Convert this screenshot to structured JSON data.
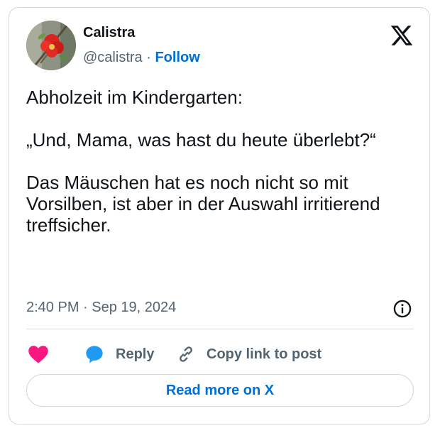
{
  "tweet": {
    "author": {
      "name": "Calistra",
      "handle": "@calistra",
      "separator": "·",
      "follow_label": "Follow"
    },
    "body": {
      "line1": "Abholzeit im Kindergarten:",
      "line2": "„Und, Mama, was hast du heute überlebt?“",
      "line3": "Das Mäuschen hat es noch nicht so mit Vorsilben, ist aber in der Auswahl irritierend treffsicher."
    },
    "timestamp": {
      "time": "2:40 PM",
      "separator": "·",
      "date": "Sep 19, 2024"
    },
    "actions": {
      "reply_label": "Reply",
      "copy_link_label": "Copy link to post"
    },
    "read_more_label": "Read more on X"
  },
  "icons": {
    "brand": "x-logo-icon",
    "like": "heart-icon",
    "reply": "speech-bubble-icon",
    "copy": "link-icon",
    "info": "info-icon"
  },
  "colors": {
    "text": "#0f1419",
    "secondary": "#536471",
    "link": "#006fd6",
    "like": "#f91880",
    "reply": "#1d9bf0",
    "border": "#cfd9de"
  }
}
